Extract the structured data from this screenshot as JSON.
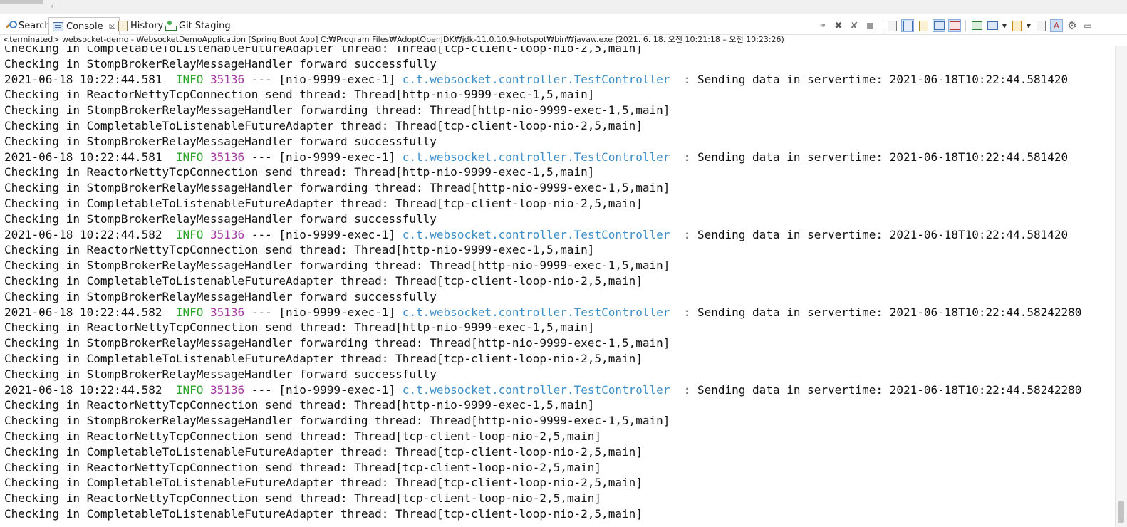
{
  "tabs": [
    {
      "label": "Search",
      "icon": "search-icon"
    },
    {
      "label": "Console",
      "icon": "console-icon",
      "close": "☒"
    },
    {
      "label": "History",
      "icon": "history-icon"
    },
    {
      "label": "Git Staging",
      "icon": "git-staging-icon"
    }
  ],
  "toolbar": {
    "icons": [
      "pin-console-icon",
      "remove-launch-icon",
      "remove-all-terminated-icon",
      "terminate-icon",
      "clear-console-icon",
      "scroll-lock-icon",
      "word-wrap-icon",
      "show-on-stdout-icon",
      "show-on-stderr-icon",
      "pin-icon",
      "display-selected-console-icon",
      "open-console-icon",
      "copy-icon",
      "search-console-icon",
      "settings-icon",
      "minimize-icon"
    ]
  },
  "status": "<terminated> websocket-demo - WebsocketDemoApplication [Spring Boot App] C:₩Program Files₩AdoptOpenJDK₩jdk-11.0.10.9-hotspot₩bin₩javaw.exe  (2021. 6. 18. 오전 10:21:18 – 오전 10:23:26)",
  "console": {
    "lines": [
      {
        "type": "plain",
        "text": "Checking in CompletableToListenableFutureAdapter thread: Thread[tcp-client-loop-nio-2,5,main]"
      },
      {
        "type": "plain",
        "text": "Checking in StompBrokerRelayMessageHandler forward successfully"
      },
      {
        "type": "log",
        "ts": "2021-06-18 10:22:44.581",
        "level": "INFO",
        "pid": "35136",
        "thread": "--- [nio-9999-exec-1]",
        "logger": "c.t.websocket.controller.TestController",
        "msg": ": Sending data in servertime: 2021-06-18T10:22:44.581420"
      },
      {
        "type": "plain",
        "text": "Checking in ReactorNettyTcpConnection send thread: Thread[http-nio-9999-exec-1,5,main]"
      },
      {
        "type": "plain",
        "text": "Checking in StompBrokerRelayMessageHandler forwarding thread: Thread[http-nio-9999-exec-1,5,main]"
      },
      {
        "type": "plain",
        "text": "Checking in CompletableToListenableFutureAdapter thread: Thread[tcp-client-loop-nio-2,5,main]"
      },
      {
        "type": "plain",
        "text": "Checking in StompBrokerRelayMessageHandler forward successfully"
      },
      {
        "type": "log",
        "ts": "2021-06-18 10:22:44.581",
        "level": "INFO",
        "pid": "35136",
        "thread": "--- [nio-9999-exec-1]",
        "logger": "c.t.websocket.controller.TestController",
        "msg": ": Sending data in servertime: 2021-06-18T10:22:44.581420"
      },
      {
        "type": "plain",
        "text": "Checking in ReactorNettyTcpConnection send thread: Thread[http-nio-9999-exec-1,5,main]"
      },
      {
        "type": "plain",
        "text": "Checking in StompBrokerRelayMessageHandler forwarding thread: Thread[http-nio-9999-exec-1,5,main]"
      },
      {
        "type": "plain",
        "text": "Checking in CompletableToListenableFutureAdapter thread: Thread[tcp-client-loop-nio-2,5,main]"
      },
      {
        "type": "plain",
        "text": "Checking in StompBrokerRelayMessageHandler forward successfully"
      },
      {
        "type": "log",
        "ts": "2021-06-18 10:22:44.582",
        "level": "INFO",
        "pid": "35136",
        "thread": "--- [nio-9999-exec-1]",
        "logger": "c.t.websocket.controller.TestController",
        "msg": ": Sending data in servertime: 2021-06-18T10:22:44.581420"
      },
      {
        "type": "plain",
        "text": "Checking in ReactorNettyTcpConnection send thread: Thread[http-nio-9999-exec-1,5,main]"
      },
      {
        "type": "plain",
        "text": "Checking in StompBrokerRelayMessageHandler forwarding thread: Thread[http-nio-9999-exec-1,5,main]"
      },
      {
        "type": "plain",
        "text": "Checking in CompletableToListenableFutureAdapter thread: Thread[tcp-client-loop-nio-2,5,main]"
      },
      {
        "type": "plain",
        "text": "Checking in StompBrokerRelayMessageHandler forward successfully"
      },
      {
        "type": "log",
        "ts": "2021-06-18 10:22:44.582",
        "level": "INFO",
        "pid": "35136",
        "thread": "--- [nio-9999-exec-1]",
        "logger": "c.t.websocket.controller.TestController",
        "msg": ": Sending data in servertime: 2021-06-18T10:22:44.58242280"
      },
      {
        "type": "plain",
        "text": "Checking in ReactorNettyTcpConnection send thread: Thread[http-nio-9999-exec-1,5,main]"
      },
      {
        "type": "plain",
        "text": "Checking in StompBrokerRelayMessageHandler forwarding thread: Thread[http-nio-9999-exec-1,5,main]"
      },
      {
        "type": "plain",
        "text": "Checking in CompletableToListenableFutureAdapter thread: Thread[tcp-client-loop-nio-2,5,main]"
      },
      {
        "type": "plain",
        "text": "Checking in StompBrokerRelayMessageHandler forward successfully"
      },
      {
        "type": "log",
        "ts": "2021-06-18 10:22:44.582",
        "level": "INFO",
        "pid": "35136",
        "thread": "--- [nio-9999-exec-1]",
        "logger": "c.t.websocket.controller.TestController",
        "msg": ": Sending data in servertime: 2021-06-18T10:22:44.58242280"
      },
      {
        "type": "plain",
        "text": "Checking in ReactorNettyTcpConnection send thread: Thread[http-nio-9999-exec-1,5,main]"
      },
      {
        "type": "plain",
        "text": "Checking in StompBrokerRelayMessageHandler forwarding thread: Thread[http-nio-9999-exec-1,5,main]"
      },
      {
        "type": "plain",
        "text": "Checking in ReactorNettyTcpConnection send thread: Thread[tcp-client-loop-nio-2,5,main]"
      },
      {
        "type": "plain",
        "text": "Checking in CompletableToListenableFutureAdapter thread: Thread[tcp-client-loop-nio-2,5,main]"
      },
      {
        "type": "plain",
        "text": "Checking in ReactorNettyTcpConnection send thread: Thread[tcp-client-loop-nio-2,5,main]"
      },
      {
        "type": "plain",
        "text": "Checking in CompletableToListenableFutureAdapter thread: Thread[tcp-client-loop-nio-2,5,main]"
      },
      {
        "type": "plain",
        "text": "Checking in ReactorNettyTcpConnection send thread: Thread[tcp-client-loop-nio-2,5,main]"
      },
      {
        "type": "plain",
        "text": "Checking in CompletableToListenableFutureAdapter thread: Thread[tcp-client-loop-nio-2,5,main]"
      }
    ]
  },
  "colors": {
    "info": "#2aa52a",
    "pid": "#a53aa5",
    "logger": "#3d8fc9"
  }
}
